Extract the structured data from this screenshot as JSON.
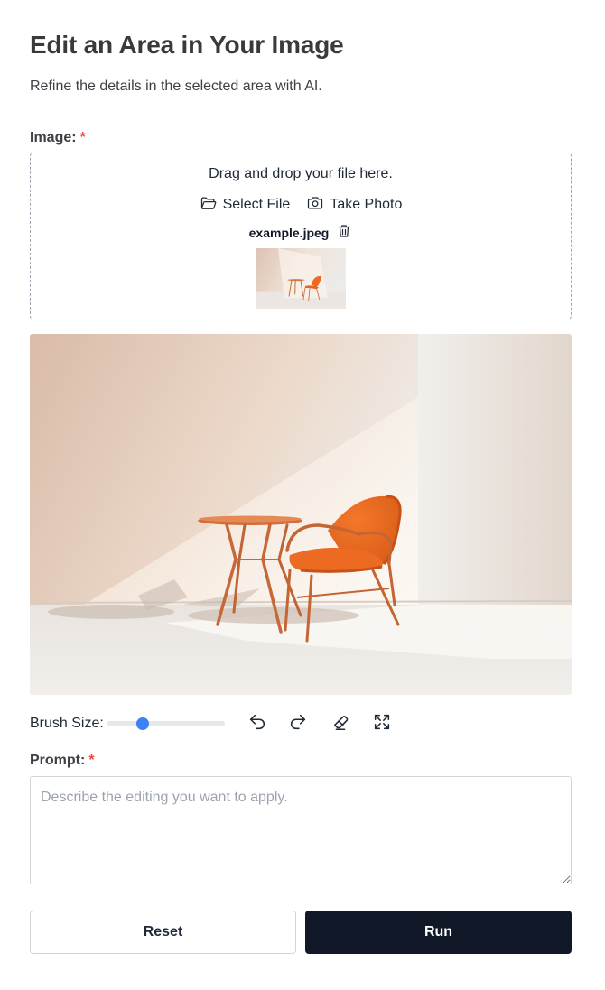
{
  "header": {
    "title": "Edit an Area in Your Image",
    "subtitle": "Refine the details in the selected area with AI."
  },
  "image_field": {
    "label": "Image:",
    "required_mark": "*",
    "dropzone_text": "Drag and drop your file here.",
    "select_file_label": "Select File",
    "take_photo_label": "Take Photo",
    "file_name": "example.jpeg"
  },
  "toolbar": {
    "brush_size_label": "Brush Size:",
    "brush_size_fraction": 0.28,
    "icons": [
      "undo-icon",
      "redo-icon",
      "eraser-icon",
      "expand-icon"
    ]
  },
  "prompt_field": {
    "label": "Prompt:",
    "required_mark": "*",
    "placeholder": "Describe the editing you want to apply.",
    "value": ""
  },
  "actions": {
    "reset_label": "Reset",
    "run_label": "Run"
  },
  "colors": {
    "required": "#ef4444",
    "slider_thumb": "#3b82f6",
    "run_button": "#111827"
  }
}
